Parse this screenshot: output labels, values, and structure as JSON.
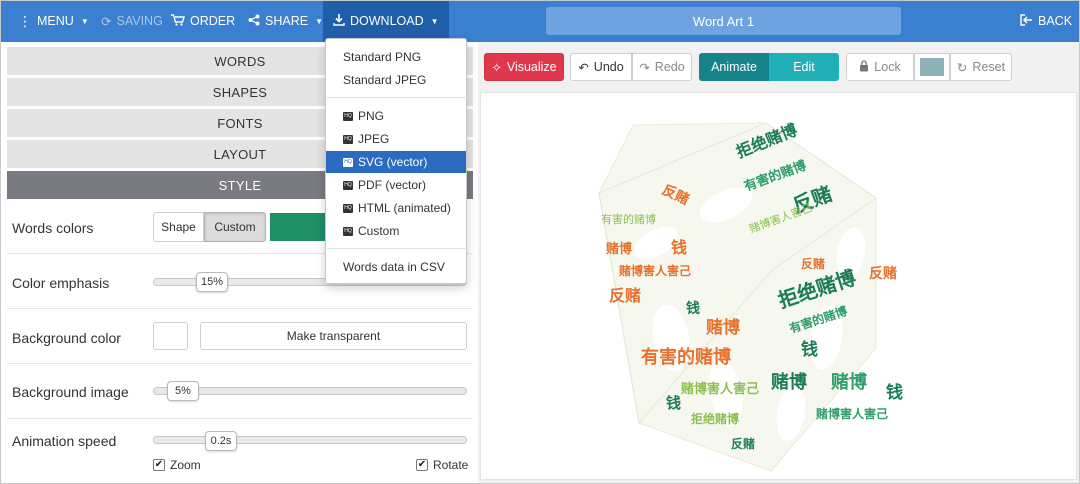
{
  "topbar": {
    "menu": "MENU",
    "saving": "SAVING",
    "order": "ORDER",
    "share": "SHARE",
    "download": "DOWNLOAD",
    "title": "Word Art 1",
    "back": "BACK"
  },
  "accordion": [
    "WORDS",
    "SHAPES",
    "FONTS",
    "LAYOUT",
    "STYLE"
  ],
  "style_panel": {
    "words_colors": {
      "label": "Words colors",
      "shape": "Shape",
      "custom": "Custom",
      "selected": "Custom",
      "swatch_color": "#1f8f65"
    },
    "color_emphasis": {
      "label": "Color emphasis",
      "value": "15%"
    },
    "background_color": {
      "label": "Background color",
      "button": "Make transparent"
    },
    "background_image": {
      "label": "Background image",
      "value": "5%"
    },
    "animation_speed": {
      "label": "Animation speed",
      "value": "0.2s",
      "zoom": "Zoom",
      "rotate": "Rotate",
      "zoom_checked": true,
      "rotate_checked": true
    }
  },
  "toolbar": {
    "visualize": "Visualize",
    "undo": "Undo",
    "redo": "Redo",
    "animate": "Animate",
    "edit": "Edit",
    "lock": "Lock",
    "lock_swatch_color": "#8fb2b8",
    "reset": "Reset"
  },
  "download_menu": {
    "standard": [
      "Standard PNG",
      "Standard JPEG"
    ],
    "hq": [
      "PNG",
      "JPEG",
      "SVG (vector)",
      "PDF (vector)",
      "HTML (animated)",
      "Custom"
    ],
    "highlighted": "SVG (vector)",
    "csv": "Words data in CSV"
  },
  "word_cloud": {
    "words": [
      "拒绝赌博",
      "有害的赌博",
      "反赌",
      "赌博",
      "钱",
      "赌博害人害己"
    ],
    "colors": [
      "#1a7d57",
      "#e8712e",
      "#8cc152",
      "#2f9e6a"
    ]
  }
}
